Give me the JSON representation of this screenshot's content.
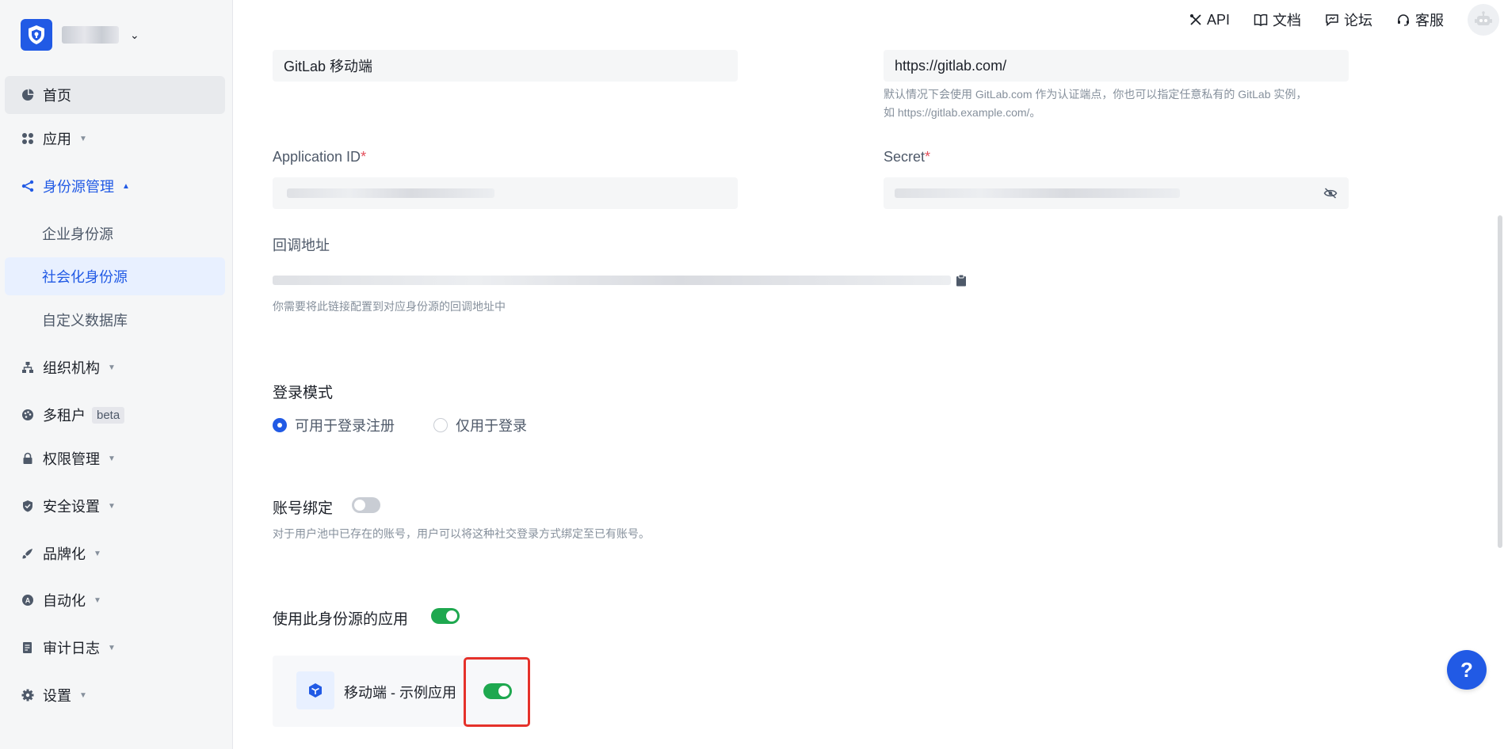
{
  "header": {
    "links": [
      {
        "label": "API",
        "icon": "api-tools-icon"
      },
      {
        "label": "文档",
        "icon": "book-icon"
      },
      {
        "label": "论坛",
        "icon": "chat-icon"
      },
      {
        "label": "客服",
        "icon": "headset-icon"
      }
    ]
  },
  "sidebar": {
    "items": [
      {
        "label": "首页"
      },
      {
        "label": "应用"
      },
      {
        "label": "身份源管理"
      },
      {
        "label": "企业身份源"
      },
      {
        "label": "社会化身份源"
      },
      {
        "label": "自定义数据库"
      },
      {
        "label": "组织机构"
      },
      {
        "label": "多租户",
        "badge": "beta"
      },
      {
        "label": "权限管理"
      },
      {
        "label": "安全设置"
      },
      {
        "label": "品牌化"
      },
      {
        "label": "自动化"
      },
      {
        "label": "审计日志"
      },
      {
        "label": "设置"
      }
    ]
  },
  "form": {
    "display_name_value": "GitLab 移动端",
    "base_url_value": "https://gitlab.com/",
    "base_url_hint_1": "默认情况下会使用 GitLab.com 作为认证端点，你也可以指定任意私有的 GitLab 实例，",
    "base_url_hint_2": "如 https://gitlab.example.com/。",
    "app_id_label": "Application ID",
    "secret_label": "Secret",
    "required_mark": "*",
    "callback_label": "回调地址",
    "callback_hint": "你需要将此链接配置到对应身份源的回调地址中",
    "login_mode_title": "登录模式",
    "login_mode_options": [
      "可用于登录注册",
      "仅用于登录"
    ],
    "login_mode_selected": "可用于登录注册",
    "account_binding_title": "账号绑定",
    "account_binding_enabled": false,
    "account_binding_hint": "对于用户池中已存在的账号，用户可以将这种社交登录方式绑定至已有账号。",
    "apps_title": "使用此身份源的应用",
    "apps_enabled": true,
    "apps": [
      {
        "name": "移动端 - 示例应用",
        "enabled": true
      }
    ]
  },
  "help_button": "?",
  "colors": {
    "primary": "#215ae5",
    "switch_on": "#1ea84f",
    "highlight": "#e5312a"
  }
}
